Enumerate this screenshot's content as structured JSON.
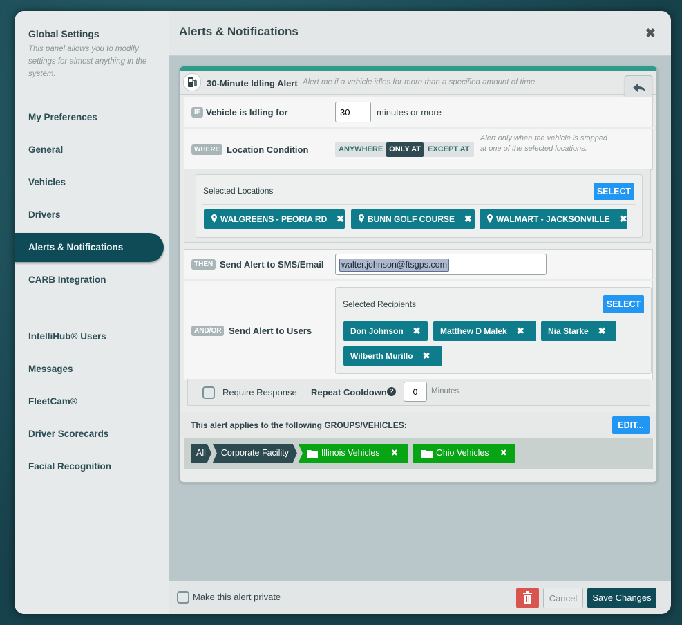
{
  "sidebar": {
    "title": "Global Settings",
    "description": "This panel allows you to modify settings for almost anything in the system.",
    "items": [
      {
        "label": "My Preferences"
      },
      {
        "label": "General"
      },
      {
        "label": "Vehicles"
      },
      {
        "label": "Drivers"
      },
      {
        "label": "Alerts & Notifications"
      },
      {
        "label": "CARB Integration"
      },
      {
        "label": "IntelliHub® Users"
      },
      {
        "label": "Messages"
      },
      {
        "label": "FleetCam®"
      },
      {
        "label": "Driver Scorecards"
      },
      {
        "label": "Facial Recognition"
      }
    ]
  },
  "header": {
    "title": "Alerts & Notifications",
    "close": "✖"
  },
  "alert": {
    "name": "30-Minute Idling Alert",
    "description": "Alert me if a vehicle idles for more than a specified amount of time.",
    "if": {
      "tag": "IF",
      "label": "Vehicle is Idling for",
      "value": "30",
      "unit": "minutes or more"
    },
    "where": {
      "tag": "WHERE",
      "label": "Location Condition",
      "options": [
        "ANYWHERE",
        "ONLY AT",
        "EXCEPT AT"
      ],
      "hint": "Alert only when the vehicle is stopped at one of the selected locations."
    },
    "locations": {
      "title": "Selected Locations",
      "select_label": "SELECT",
      "items": [
        "WALGREENS - PEORIA RD",
        "BUNN GOLF COURSE",
        "WALMART - JACKSONVILLE"
      ]
    },
    "then": {
      "tag": "THEN",
      "label": "Send Alert to SMS/Email",
      "email": "walter.johnson@ftsgps.com"
    },
    "andor": {
      "tag": "AND/OR",
      "label": "Send Alert to Users",
      "title": "Selected Recipients",
      "select_label": "SELECT",
      "recipients": [
        "Don Johnson",
        "Matthew D Malek",
        "Nia Starke",
        "Wilberth Murillo"
      ]
    },
    "require_response": "Require Response",
    "repeat_cooldown": {
      "label": "Repeat Cooldown",
      "value": "0",
      "unit": "Minutes"
    },
    "groups": {
      "title": "This alert applies to the following GROUPS/VEHICLES:",
      "edit_label": "EDIT...",
      "breadcrumb": [
        "All",
        "Corporate Facility"
      ],
      "folders": [
        "Illinois Vehicles",
        "Ohio Vehicles"
      ]
    }
  },
  "footer": {
    "private_label": "Make this alert private",
    "cancel_label": "Cancel",
    "save_label": "Save Changes"
  },
  "colors": {
    "accent": "#0e7c8a",
    "active_nav": "#0f4a57",
    "green": "#07a414",
    "blue": "#2196f3",
    "delete": "#d9534f"
  }
}
